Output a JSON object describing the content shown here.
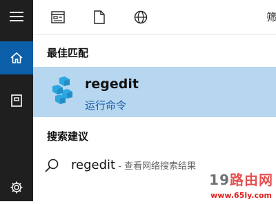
{
  "topbar": {
    "icons": [
      "apps-icon",
      "document-icon",
      "globe-icon"
    ],
    "filter_label": "筛"
  },
  "sidebar": {
    "items": [
      "hamburger-menu-icon",
      "home-icon",
      "notebook-icon",
      "settings-icon"
    ]
  },
  "best_match": {
    "section_title": "最佳匹配",
    "app_name": "regedit",
    "app_subtitle": "运行命令"
  },
  "suggestions": {
    "section_title": "搜索建议",
    "items": [
      {
        "query": "regedit",
        "hint": " - 查看网络搜索结果"
      }
    ]
  },
  "watermark": {
    "text_gray": "19",
    "text_red": "路由网",
    "url": "www.65ly.com"
  },
  "colors": {
    "rail": "#1f1f1f",
    "home_active": "#0b5ea8",
    "selection": "#b7d6ef",
    "accent_text": "#1a5fa8"
  }
}
